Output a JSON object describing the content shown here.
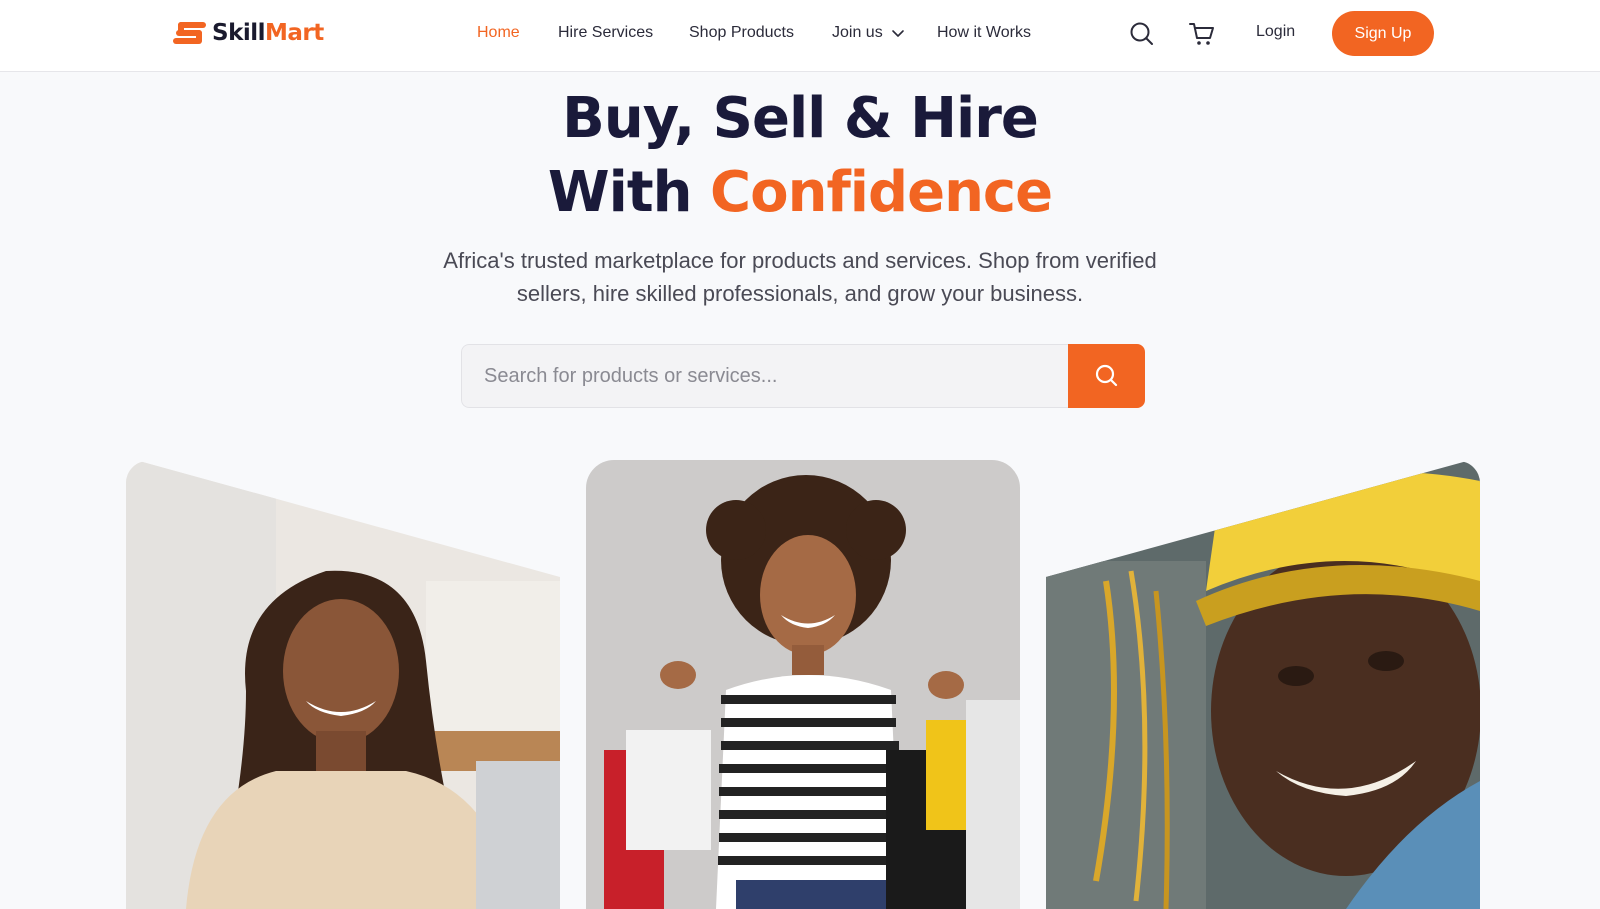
{
  "brand": {
    "name_part1": "Skill",
    "name_part2": "Mart",
    "accent_color": "#f26522",
    "dark_color": "#1a1a3a"
  },
  "nav": {
    "items": [
      {
        "label": "Home",
        "active": true
      },
      {
        "label": "Hire Services"
      },
      {
        "label": "Shop Products"
      },
      {
        "label": "Join us",
        "has_dropdown": true
      },
      {
        "label": "How it Works"
      }
    ],
    "icons": [
      "search-icon",
      "cart-icon",
      "chevron-down-icon"
    ],
    "login_label": "Login",
    "signup_label": "Sign Up"
  },
  "hero": {
    "title_line1": "Buy, Sell & Hire",
    "title_line2_prefix": "With",
    "title_line2_accent": "Confidence",
    "subtitle": "Africa's trusted marketplace for products and services. Shop from verified sellers, hire skilled professionals, and grow your business.",
    "search_placeholder": "Search for products or services..."
  }
}
